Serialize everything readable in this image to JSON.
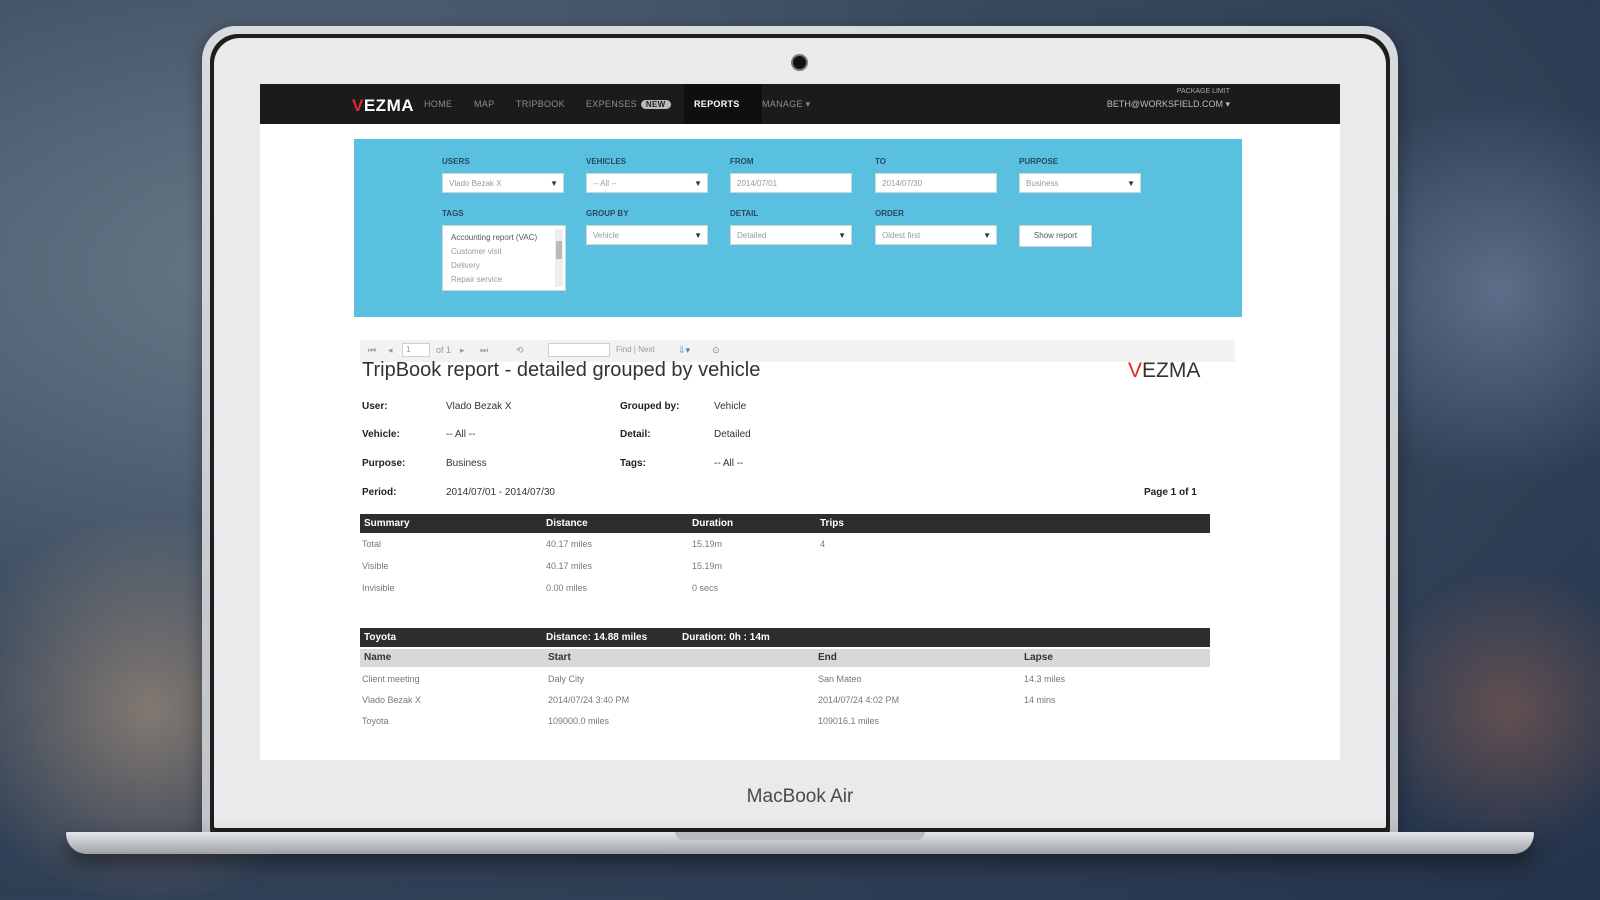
{
  "device": {
    "brand_label": "MacBook Air"
  },
  "nav": {
    "logo": {
      "v": "V",
      "rest": "EZMA"
    },
    "items": [
      {
        "label": "HOME"
      },
      {
        "label": "MAP"
      },
      {
        "label": "TRIPBOOK"
      },
      {
        "label": "EXPENSES",
        "badge": "NEW"
      },
      {
        "label": "REPORTS"
      },
      {
        "label": "MANAGE ▾"
      }
    ],
    "account": {
      "package": "PACKAGE LIMIT",
      "email": "BETH@WORKSFIELD.COM ▾"
    }
  },
  "filters": {
    "users": {
      "label": "USERS",
      "value": "Vlado Bezak X"
    },
    "vehicles": {
      "label": "VEHICLES",
      "value": "-- All --"
    },
    "from": {
      "label": "FROM",
      "value": "2014/07/01"
    },
    "to": {
      "label": "TO",
      "value": "2014/07/30"
    },
    "purpose": {
      "label": "PURPOSE",
      "value": "Business"
    },
    "tags": {
      "label": "TAGS",
      "options": [
        "Accounting report (VAC)",
        "Customer visit",
        "Delivery",
        "Repair service"
      ]
    },
    "group_by": {
      "label": "GROUP BY",
      "value": "Vehicle"
    },
    "detail": {
      "label": "DETAIL",
      "value": "Detailed"
    },
    "order": {
      "label": "ORDER",
      "value": "Oldest first"
    },
    "show_report": "Show report"
  },
  "toolbar": {
    "page_input": "1",
    "of_pages": "of 1",
    "find_next": "Find | Next"
  },
  "report": {
    "title": "TripBook report - detailed grouped by vehicle",
    "logo": {
      "v": "V",
      "rest": "EZMA"
    },
    "meta": {
      "user_label": "User:",
      "user_value": "Vlado Bezak X",
      "grouped_label": "Grouped by:",
      "grouped_value": "Vehicle",
      "vehicle_label": "Vehicle:",
      "vehicle_value": "-- All --",
      "detail_label": "Detail:",
      "detail_value": "Detailed",
      "purpose_label": "Purpose:",
      "purpose_value": "Business",
      "tags_label": "Tags:",
      "tags_value": "-- All --",
      "period_label": "Period:",
      "period_value": "2014/07/01 - 2014/07/30",
      "page": "Page 1 of 1"
    },
    "summary": {
      "headers": [
        "Summary",
        "Distance",
        "Duration",
        "Trips"
      ],
      "rows": [
        [
          "Total",
          "40.17 miles",
          "15.19m",
          "4"
        ],
        [
          "Visible",
          "40.17 miles",
          "15.19m",
          ""
        ],
        [
          "Invisible",
          "0.00 miles",
          "0 secs",
          ""
        ]
      ]
    },
    "group": {
      "name": "Toyota",
      "distance": "Distance: 14.88 miles",
      "duration": "Duration: 0h : 14m",
      "headers": [
        "Name",
        "Start",
        "End",
        "Lapse"
      ],
      "rows": [
        [
          "Client meeting",
          "Daly City",
          "San Mateo",
          "14.3 miles"
        ],
        [
          "Vlado Bezak X",
          "2014/07/24 3:40 PM",
          "2014/07/24 4:02 PM",
          "14 mins"
        ],
        [
          "Toyota",
          "109000.0 miles",
          "109016.1 miles",
          ""
        ]
      ]
    }
  },
  "colors": {
    "accent_red": "#e3262b",
    "filter_blue": "#5ac0e0",
    "nav_dark": "#1b1b1b"
  }
}
